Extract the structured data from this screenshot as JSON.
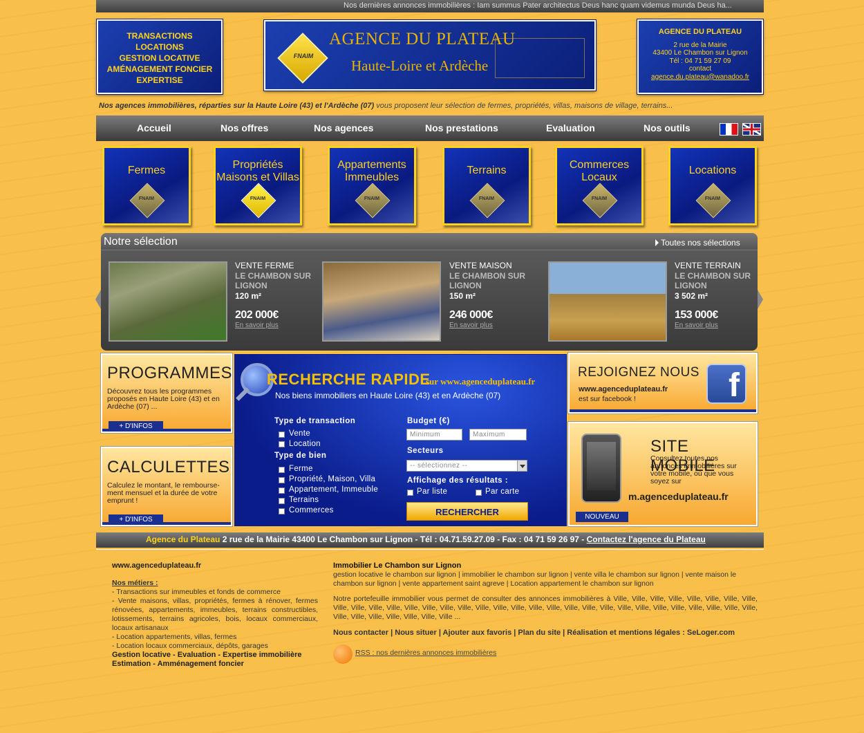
{
  "ticker": "Nos dernières annonces immobilières  : Iam summus Pater architectus Deus hanc quam videmus munda Deus ha...",
  "services": [
    "TRANSACTIONS",
    "LOCATIONS",
    "GESTION LOCATIVE",
    "AMÉNAGEMENT FONCIER",
    "EXPERTISE"
  ],
  "logo": {
    "title": "AGENCE DU PLATEAU",
    "subtitle": "Haute-Loire et Ardèche",
    "badge": "FNAIM"
  },
  "contact": {
    "title": "AGENCE DU PLATEAU",
    "address": "2 rue de la Mairie",
    "city": "43400 Le Chambon sur Lignon",
    "phone": "Tél : 04 71 59 27 09",
    "label": "contact",
    "email": "agence.du.plateau@wanadoo.fr"
  },
  "intro": {
    "bold": "Nos agences immobilières, réparties sur la Haute Loire (43) et l'Ardèche (07)",
    "rest": " vous proposent leur sélection de fermes, propriétés, villas, maisons de village, terrains..."
  },
  "nav": [
    "Accueil",
    "Nos offres",
    "Nos agences",
    "Nos prestations",
    "Evaluation",
    "Nos outils"
  ],
  "categories": [
    {
      "label": "Fermes",
      "badge": "FNAIM"
    },
    {
      "label": "Propriétés\nMaisons et Villas",
      "badge": "FNAIM"
    },
    {
      "label": "Appartements\nImmeubles",
      "badge": "FNAIM"
    },
    {
      "label": "Terrains",
      "badge": "FNAIM"
    },
    {
      "label": "Commerces\nLocaux",
      "badge": "FNAIM"
    },
    {
      "label": "Locations",
      "badge": "FNAIM"
    }
  ],
  "selection": {
    "title": "Notre sélection",
    "all": "Toutes nos sélections",
    "items": [
      {
        "type": "VENTE FERME",
        "location": "LE CHAMBON SUR LIGNON",
        "size": "120 m²",
        "price": "202 000€",
        "more": "En savoir plus"
      },
      {
        "type": "VENTE MAISON",
        "location": "LE CHAMBON SUR LIGNON",
        "size": "150 m²",
        "price": "246 000€",
        "more": "En savoir plus"
      },
      {
        "type": "VENTE TERRAIN",
        "location": "LE CHAMBON SUR LIGNON",
        "size": "3 502 m²",
        "price": "153 000€",
        "more": "En savoir plus"
      }
    ]
  },
  "programmes": {
    "title": "PROGRAMMES",
    "text": "Découvrez tous les programmes proposés en Haute Loire (43) et en Ardèche (07) ...",
    "btn": "+ D'INFOS"
  },
  "calculettes": {
    "title": "CALCULETTES",
    "text": "Calculez le montant, le rembourse-ment mensuel et la durée de votre emprunt !",
    "btn": "+ D'INFOS"
  },
  "search": {
    "title": "RECHERCHE RAPIDE",
    "site": "sur www.agenceduplateau.fr",
    "subtitle": "Nos biens immobiliers en Haute Loire (43) et en Ardèche (07)",
    "transaction_label": "Type de transaction",
    "transactions": [
      "Vente",
      "Location"
    ],
    "bien_label": "Type de bien",
    "biens": [
      "Ferme",
      "Propriété, Maison, Villa",
      "Appartement, Immeuble",
      "Terrains",
      "Commerces"
    ],
    "budget_label": "Budget (€)",
    "min_placeholder": "Minimum",
    "max_placeholder": "Maximum",
    "secteurs_label": "Secteurs",
    "secteurs_value": "-- sélectionnez --",
    "affichage_label": "Affichage des résultats :",
    "affichage": [
      "Par liste",
      "Par carte"
    ],
    "button": "RECHERCHER"
  },
  "facebook": {
    "title": "REJOIGNEZ NOUS",
    "site": "www.agenceduplateau.fr",
    "text": "est sur facebook !",
    "logo": "f"
  },
  "mobile": {
    "title": "SITE MOBILE",
    "text": "Consultez toutes nos annonces immobilières sur votre mobile, où que vous soyez sur",
    "url": "m.agenceduplateau.fr",
    "badge": "NOUVEAU"
  },
  "footer_bar": {
    "name": "Agence du Plateau",
    "details": "  2 rue de la Mairie 43400 Le Chambon sur Lignon - Tél : 04.71.59.27.09 - Fax : 04 71 59 26 97 - ",
    "link": "Contactez l'agence du Plateau"
  },
  "footer_left": {
    "site": "www.agenceduplateau.fr",
    "metiers_title": "Nos métiers :",
    "metiers": [
      "- Transactions sur immeubles et fonds de commerce",
      "- Vente maisons, villas, propriétés, fermes à rénover, fermes rénovées, appartements, immeubles, terrains constructibles, lotissements, terrains agricoles, bois, locaux commerciaux, locaux artisanaux",
      "- Location appartements, villas, fermes",
      "- Location locaux commerciaux, dépôts, garages"
    ],
    "bold1": "Gestion locative - Evaluation - Expertise immobilière",
    "bold2": "Estimation - Amménagement foncier"
  },
  "footer_right": {
    "title": "Immobilier Le Chambon sur Lignon",
    "keywords": "gestion locative le chambon sur lignon | immobilier le chambon sur lignon  |  vente villa le chambon sur lignon | vente maison le chambon sur lignon  |  vente appartement saint agreve | Location appartement le chambon sur lignon",
    "portfolio": "Notre portefeuille immobilier vous permet de consulter des annonces immobilières à  Ville, Ville, Ville, Ville, Ville, Ville, Ville, Ville, Ville, Ville, Ville, Ville, Ville, Ville, Ville, Ville, Ville, Ville, Ville, Ville, Ville, Ville, Ville, Ville, Ville, Ville, Ville, Ville, Ville, Ville, Ville, Ville, Ville, Ville, Ville, Ville, Ville, Ville, Ville ...",
    "links": "Nous contacter | Nous situer |  Ajouter aux favoris | Plan du site |  Réalisation et mentions légales : SeLoger.com",
    "rss": "RSS : nos dernières annonces immobilières"
  }
}
